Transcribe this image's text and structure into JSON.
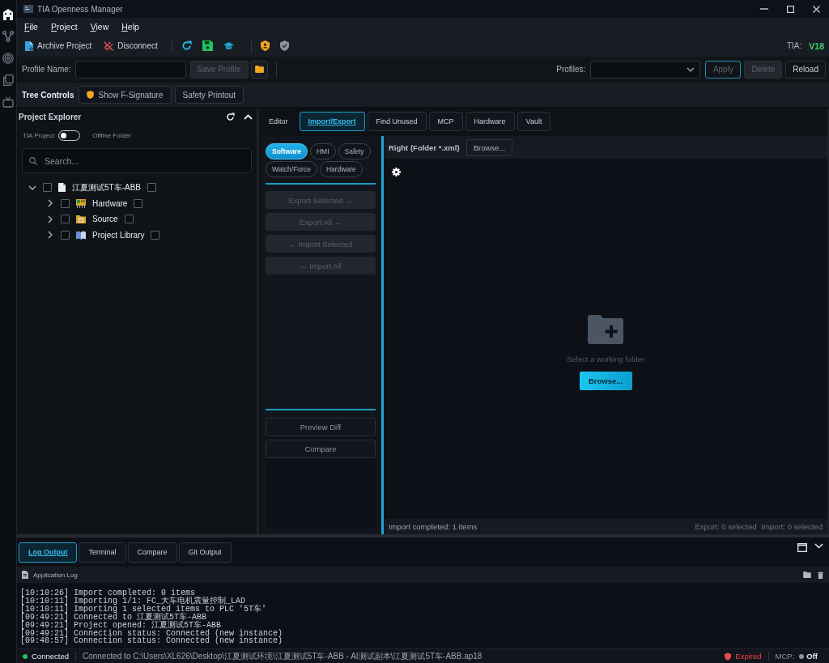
{
  "activity_bar": [
    {
      "selected": true
    },
    {
      "selected": false
    },
    {
      "selected": false
    },
    {
      "selected": false
    },
    {
      "selected": false
    }
  ],
  "window": {
    "title": "TIA Openness Manager"
  },
  "menu": [
    {
      "label": "File"
    },
    {
      "label": "Project"
    },
    {
      "label": "View"
    },
    {
      "label": "Help"
    }
  ],
  "toolbar": {
    "buttons": [
      {
        "label": "Archive Project",
        "kind": "archive"
      },
      {
        "label": "Disconnect",
        "kind": "disconnect"
      }
    ],
    "tia_label": "TIA:",
    "tia_version": "V18"
  },
  "profile_bar": {
    "name_label": "Profile Name:",
    "save_button": {
      "label": "Save Profile",
      "disabled": true
    },
    "profiles_label": "Profiles:",
    "buttons": [
      {
        "label": "Apply",
        "disabled": true,
        "focused": true
      },
      {
        "label": "Delete",
        "disabled": true,
        "focused": false
      },
      {
        "label": "Reload",
        "disabled": false,
        "focused": false
      }
    ]
  },
  "tree_controls": {
    "title": "Tree Controls",
    "buttons": [
      {
        "label": "Show F-Signature",
        "kind": "signature"
      },
      {
        "label": "Safety Printout",
        "kind": "plain"
      }
    ]
  },
  "explorer": {
    "title": "Project Explorer",
    "toggle": {
      "left_label": "TIA Project",
      "right_label": "Offline Folder",
      "on": false
    },
    "search": {
      "placeholder": "Search..."
    },
    "tree": [
      {
        "label": "江夏测试5T车-ABB",
        "kind": "project",
        "expanded": true,
        "checked": false,
        "flag_checked": false,
        "children": [
          {
            "label": "Hardware",
            "kind": "hardware",
            "expanded": false,
            "checked": false,
            "flag_checked": false
          },
          {
            "label": "Source",
            "kind": "source",
            "expanded": false,
            "checked": false,
            "flag_checked": false
          },
          {
            "label": "Project Library",
            "kind": "library",
            "expanded": false,
            "checked": false,
            "flag_checked": false
          }
        ]
      }
    ]
  },
  "tabs": [
    {
      "label": "Editor",
      "selected": false,
      "kind": "plain"
    },
    {
      "label": "Import/Export",
      "selected": true,
      "kind": "boxed"
    },
    {
      "label": "Find Unused",
      "selected": false,
      "kind": "boxed"
    },
    {
      "label": "MCP",
      "selected": false,
      "kind": "boxed"
    },
    {
      "label": "Hardware",
      "selected": false,
      "kind": "boxed"
    },
    {
      "label": "Vault",
      "selected": false,
      "kind": "boxed"
    }
  ],
  "import_export": {
    "categories": [
      {
        "label": "Software",
        "selected": true
      },
      {
        "label": "HMI",
        "selected": false
      },
      {
        "label": "Safety",
        "selected": false
      },
      {
        "label": "Watch/Force",
        "selected": false
      },
      {
        "label": "Hardware",
        "selected": false
      }
    ],
    "actions": [
      {
        "label": "Export Selected →",
        "disabled": true
      },
      {
        "label": "Export All →",
        "disabled": true
      },
      {
        "label": "← Import Selected",
        "disabled": true
      },
      {
        "label": "← Import All",
        "disabled": true
      }
    ],
    "compare_actions": [
      {
        "label": "Preview Diff",
        "disabled": false
      },
      {
        "label": "Compare",
        "disabled": false
      }
    ]
  },
  "right_panel": {
    "title": "Right (Folder *.xml)",
    "browse_button": "Browse...",
    "empty_message": "Select a working folder",
    "empty_button": "Browse...",
    "status": "Import completed: 1 items",
    "export_count": "Export: 0 selected",
    "import_count": "Import: 0 selected"
  },
  "bottom_panel": {
    "tabs": [
      {
        "label": "Log Output",
        "selected": true
      },
      {
        "label": "Terminal",
        "selected": false
      },
      {
        "label": "Compare",
        "selected": false
      },
      {
        "label": "Git Output",
        "selected": false
      }
    ],
    "log_title": "Application Log",
    "log_lines": [
      "[10:10:26] Import completed: 0 items",
      "[10:10:11] Importing 1/1: FC_大车电机震量控制_LAD",
      "[10:10:11] Importing 1 selected items to PLC '5T车'",
      "[09:49:21] Connected to 江夏测试5T车-ABB",
      "[09:49:21] Project opened: 江夏测试5T车-ABB",
      "[09:49:21] Connection status: Connected (new instance)",
      "[09:48:57] Connection status: Connected (new instance)"
    ]
  },
  "status_bar": {
    "connection": {
      "label": "Connected",
      "connected": true
    },
    "path": "Connected to C:\\Users\\XL626\\Desktop\\江夏测试环境\\江夏测试5T车-ABB - AI测试副本\\江夏测试5T车-ABB.ap18",
    "license": {
      "label": "Expired",
      "expired": true
    },
    "mcp": {
      "label": "MCP:",
      "value": "Off",
      "on": false
    }
  }
}
